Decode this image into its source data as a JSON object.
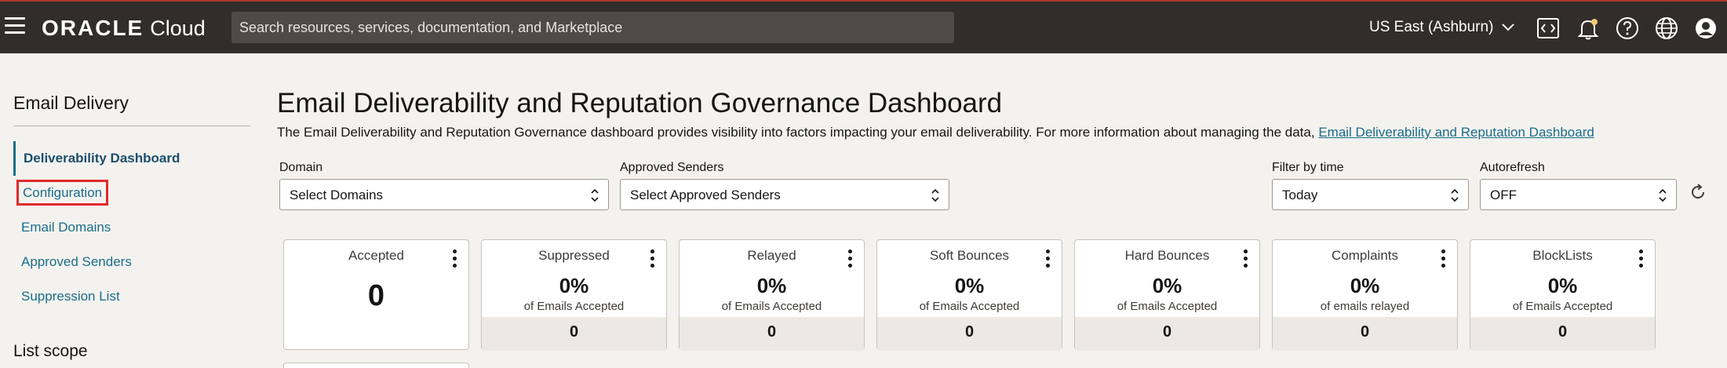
{
  "header": {
    "logo_oracle": "ORACLE",
    "logo_cloud": "Cloud",
    "search_placeholder": "Search resources, services, documentation, and Marketplace",
    "region": "US East (Ashburn)",
    "icons": [
      "hamburger-menu-icon",
      "code-editor-icon",
      "notification-bell-icon",
      "help-icon",
      "language-globe-icon",
      "user-profile-icon"
    ]
  },
  "sidebar": {
    "title": "Email Delivery",
    "items": [
      {
        "label": "Deliverability Dashboard",
        "active": true
      },
      {
        "label": "Configuration",
        "highlighted": true
      },
      {
        "label": "Email Domains"
      },
      {
        "label": "Approved Senders"
      },
      {
        "label": "Suppression List"
      }
    ],
    "list_scope": "List scope"
  },
  "main": {
    "title": "Email Deliverability and Reputation Governance Dashboard",
    "description": "The Email Deliverability and Reputation Governance dashboard provides visibility into factors impacting your email deliverability. For more information about managing the data,",
    "description_link": "Email Deliverability and Reputation Dashboard",
    "filters": {
      "domain_label": "Domain",
      "domain_value": "Select Domains",
      "senders_label": "Approved Senders",
      "senders_value": "Select Approved Senders",
      "time_label": "Filter by time",
      "time_value": "Today",
      "autorefresh_label": "Autorefresh",
      "autorefresh_value": "OFF"
    },
    "cards": [
      {
        "title": "Accepted",
        "value": "0"
      },
      {
        "title": "Suppressed",
        "percent": "0%",
        "sub": "of Emails Accepted",
        "count": "0"
      },
      {
        "title": "Relayed",
        "percent": "0%",
        "sub": "of Emails Accepted",
        "count": "0"
      },
      {
        "title": "Soft Bounces",
        "percent": "0%",
        "sub": "of Emails Accepted",
        "count": "0"
      },
      {
        "title": "Hard Bounces",
        "percent": "0%",
        "sub": "of Emails Accepted",
        "count": "0"
      },
      {
        "title": "Complaints",
        "percent": "0%",
        "sub": "of emails relayed",
        "count": "0"
      },
      {
        "title": "BlockLists",
        "percent": "0%",
        "sub": "of Emails Accepted",
        "count": "0"
      }
    ]
  },
  "colors": {
    "header_bg": "#312d2a",
    "link": "#196d8a",
    "highlight": "#e02a2a"
  }
}
